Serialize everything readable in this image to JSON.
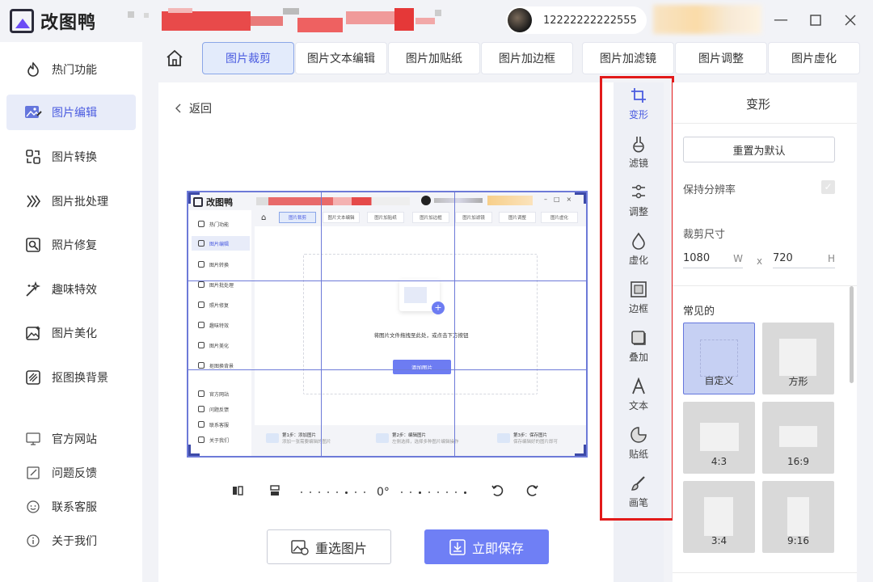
{
  "app": {
    "name": "改图鸭",
    "user_id": "12222222222555"
  },
  "sidebar": {
    "items": [
      {
        "label": "热门功能",
        "icon": "flame-icon"
      },
      {
        "label": "图片编辑",
        "icon": "image-edit-icon"
      },
      {
        "label": "图片转换",
        "icon": "convert-icon"
      },
      {
        "label": "图片批处理",
        "icon": "batch-icon"
      },
      {
        "label": "照片修复",
        "icon": "photo-repair-icon"
      },
      {
        "label": "趣味特效",
        "icon": "magic-wand-icon"
      },
      {
        "label": "图片美化",
        "icon": "beautify-icon"
      },
      {
        "label": "抠图换背景",
        "icon": "cutout-icon"
      }
    ],
    "footer": [
      {
        "label": "官方网站",
        "icon": "monitor-icon"
      },
      {
        "label": "问题反馈",
        "icon": "feedback-icon"
      },
      {
        "label": "联系客服",
        "icon": "support-icon"
      },
      {
        "label": "关于我们",
        "icon": "info-icon"
      }
    ]
  },
  "tabs": [
    "图片裁剪",
    "图片文本编辑",
    "图片加贴纸",
    "图片加边框",
    "图片加滤镜",
    "图片调整",
    "图片虚化"
  ],
  "canvas": {
    "back_label": "返回",
    "rotation": "0°",
    "reselect_label": "重选图片",
    "save_label": "立即保存"
  },
  "preview": {
    "app_name": "改图鸭",
    "nav": [
      "热门功能",
      "图片编辑",
      "图片转换",
      "图片批处理",
      "照片修复",
      "趣味特效",
      "图片美化",
      "抠图换背景"
    ],
    "footer": [
      "官方网站",
      "问题反馈",
      "联系客服",
      "关于我们"
    ],
    "tabs": [
      "图片裁剪",
      "图片文本编辑",
      "图片加贴纸",
      "图片加边框",
      "图片加滤镜",
      "图片调整",
      "图片虚化"
    ],
    "drop_text": "将图片文件拖拽至此处，或点击下方按钮",
    "add_button": "添加图片",
    "steps": [
      {
        "title": "第1步：添加图片",
        "desc": "添加一张需要编辑的图片"
      },
      {
        "title": "第2步：编辑图片",
        "desc": "左侧选择，选择多种图片编辑操作"
      },
      {
        "title": "第3步：保存图片",
        "desc": "保存编辑好的图片即可"
      }
    ]
  },
  "tools": [
    {
      "label": "变形",
      "icon": "crop-icon"
    },
    {
      "label": "滤镜",
      "icon": "filter-icon"
    },
    {
      "label": "调整",
      "icon": "adjust-icon"
    },
    {
      "label": "虚化",
      "icon": "blur-drop-icon"
    },
    {
      "label": "边框",
      "icon": "frame-icon"
    },
    {
      "label": "叠加",
      "icon": "overlay-icon"
    },
    {
      "label": "文本",
      "icon": "text-icon"
    },
    {
      "label": "贴纸",
      "icon": "sticker-icon"
    },
    {
      "label": "画笔",
      "icon": "brush-icon"
    }
  ],
  "panel": {
    "title": "变形",
    "reset_label": "重置为默认",
    "keep_resolution_label": "保持分辨率",
    "crop_size_label": "裁剪尺寸",
    "width": "1080",
    "width_unit": "W",
    "times": "x",
    "height": "720",
    "height_unit": "H",
    "common_label": "常见的",
    "presets": [
      "自定义",
      "方形",
      "4:3",
      "16:9",
      "3:4",
      "9:16"
    ]
  },
  "colors": {
    "accent": "#4a5be0",
    "save_button": "#6f7ff5",
    "highlight_box": "#e21a1a"
  }
}
